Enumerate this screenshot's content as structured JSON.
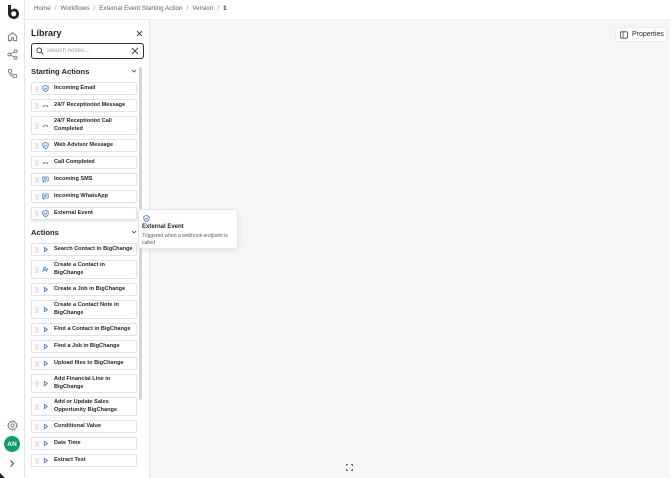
{
  "colors": {
    "accent": "#0f9d73",
    "icon_blue": "#3b6fd8",
    "text": "#1f2328"
  },
  "rail": {
    "icons": [
      "logo-icon",
      "home-icon",
      "workflow-icon",
      "phone-icon",
      "settings-icon",
      "chevron-right-icon"
    ],
    "avatar": "AN"
  },
  "breadcrumb": {
    "items": [
      "Home",
      "Workflows",
      "External Event Starting Action",
      "Version"
    ],
    "current": "1",
    "separator": "/"
  },
  "library": {
    "title": "Library",
    "search_placeholder": "Search nodes...",
    "sections": {
      "starting": {
        "title": "Starting Actions",
        "items": [
          {
            "label": "Incoming Email",
            "icon": "shield-icon"
          },
          {
            "label": "24/7 Receptionist Message",
            "icon": "phone-icon"
          },
          {
            "label": "24/7 Receptionist Call Completed",
            "icon": "phone-icon"
          },
          {
            "label": "Web Advisor Message",
            "icon": "shield-icon"
          },
          {
            "label": "Call Completed",
            "icon": "phone-icon"
          },
          {
            "label": "Incoming SMS",
            "icon": "chat-icon"
          },
          {
            "label": "Incoming WhatsApp",
            "icon": "chat-icon"
          },
          {
            "label": "External Event",
            "icon": "shield-icon"
          }
        ]
      },
      "actions": {
        "title": "Actions",
        "items": [
          {
            "label": "Search Contact in BigChange",
            "icon": "play-icon"
          },
          {
            "label": "Create a Contact in BigChange",
            "icon": "add-user-icon"
          },
          {
            "label": "Create a Job in BigChange",
            "icon": "play-icon"
          },
          {
            "label": "Create a Contact Note in BigChange",
            "icon": "play-icon"
          },
          {
            "label": "Find a Contact in BigChange",
            "icon": "play-icon"
          },
          {
            "label": "Find a Job in BigChange",
            "icon": "play-icon"
          },
          {
            "label": "Upload files to BigChange",
            "icon": "play-icon"
          },
          {
            "label": "Add Financial Line in BigChange",
            "icon": "play-icon"
          },
          {
            "label": "Add or Update Sales Opportunity BigChange",
            "icon": "play-icon"
          },
          {
            "label": "Conditional Value",
            "icon": "play-icon"
          },
          {
            "label": "Date Time",
            "icon": "play-icon"
          },
          {
            "label": "Extract Text",
            "icon": "play-icon"
          }
        ]
      }
    }
  },
  "tooltip": {
    "title": "External Event",
    "description": "Triggered when a webhook endpoint is called"
  },
  "canvas": {
    "properties_label": "Properties"
  }
}
